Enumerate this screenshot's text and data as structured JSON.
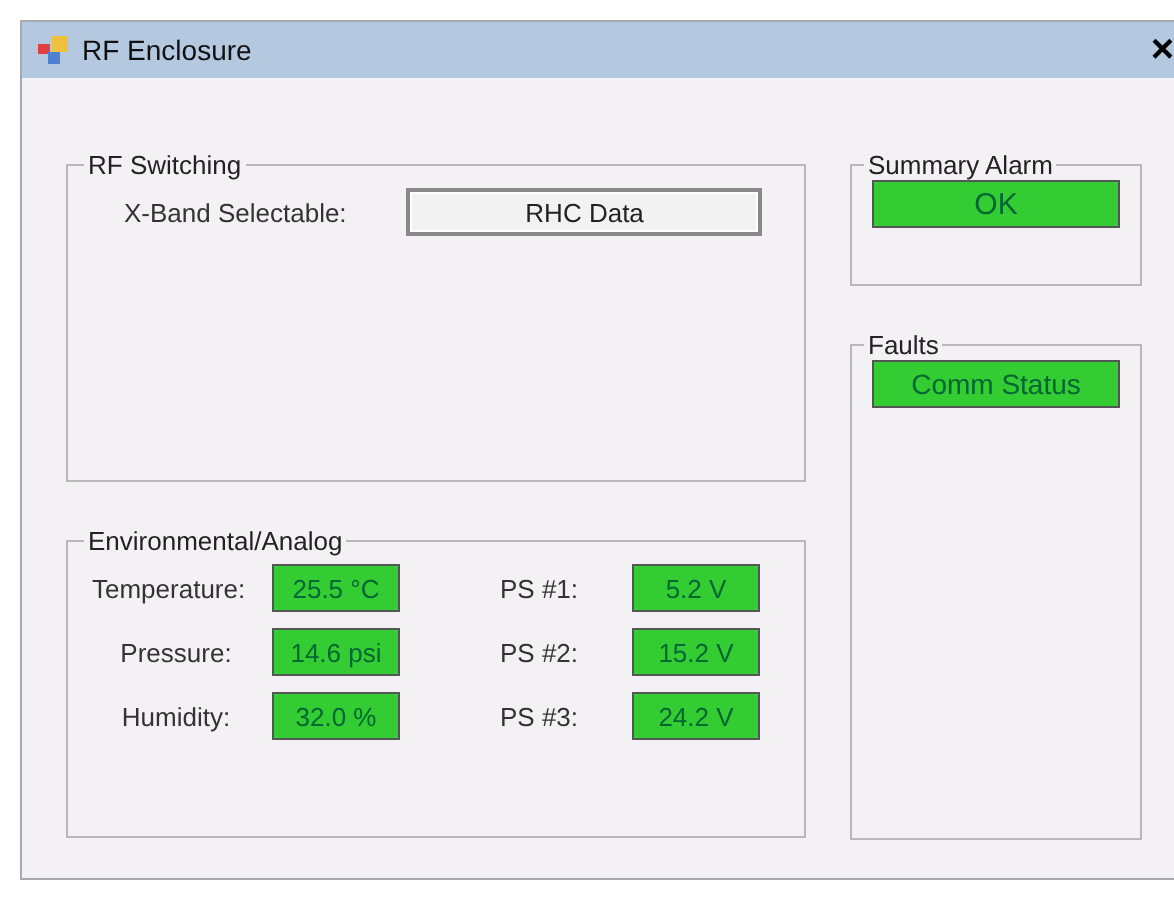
{
  "window": {
    "title": "RF Enclosure",
    "close": "×"
  },
  "rf_switching": {
    "title": "RF Switching",
    "label": "X-Band Selectable:",
    "button": "RHC Data"
  },
  "environmental": {
    "title": "Environmental/Analog",
    "readings": [
      {
        "label": "Temperature:",
        "value": "25.5 °C",
        "color": "#33cc33"
      },
      {
        "label": "PS #1:",
        "value": "5.2 V",
        "color": "#33cc33"
      },
      {
        "label": "Pressure:",
        "value": "14.6 psi",
        "color": "#33cc33"
      },
      {
        "label": "PS #2:",
        "value": "15.2 V",
        "color": "#33cc33"
      },
      {
        "label": "Humidity:",
        "value": "32.0 %",
        "color": "#33cc33"
      },
      {
        "label": "PS #3:",
        "value": "24.2 V",
        "color": "#33cc33"
      }
    ]
  },
  "summary_alarm": {
    "title": "Summary Alarm",
    "value": "OK",
    "color": "#33cc33"
  },
  "faults": {
    "title": "Faults",
    "items": [
      {
        "label": "Comm Status",
        "color": "#33cc33"
      }
    ]
  }
}
